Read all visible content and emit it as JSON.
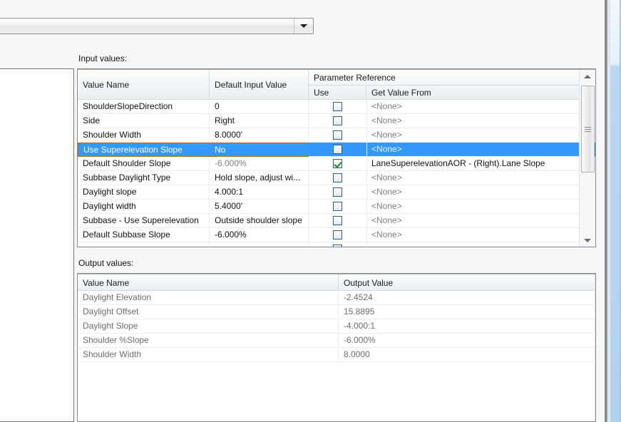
{
  "combo": {
    "value": "",
    "placeholder": "",
    "arrow_icon": "chevron-down-icon"
  },
  "sections": {
    "input_caption": "Input values:",
    "output_caption": "Output values:"
  },
  "input_table": {
    "headers": {
      "value_name": "Value Name",
      "default_input_value": "Default Input Value",
      "parameter_reference": "Parameter Reference",
      "use": "Use",
      "get_value_from": "Get Value From"
    },
    "rows": [
      {
        "name": "ShoulderSlopeDirection",
        "value": "0",
        "value_dim": false,
        "use": false,
        "source": "<None>",
        "source_dim": true,
        "selected": false
      },
      {
        "name": "Side",
        "value": "Right",
        "value_dim": false,
        "use": false,
        "source": "<None>",
        "source_dim": true,
        "selected": false
      },
      {
        "name": "Shoulder Width",
        "value": "8.0000'",
        "value_dim": false,
        "use": false,
        "source": "<None>",
        "source_dim": true,
        "selected": false
      },
      {
        "name": "Use Superelevation Slope",
        "value": "No",
        "value_dim": false,
        "use": false,
        "source": "<None>",
        "source_dim": true,
        "selected": true
      },
      {
        "name": "Default Shoulder Slope",
        "value": "-6.000%",
        "value_dim": true,
        "use": true,
        "source": "LaneSuperelevationAOR - (Right).Lane Slope",
        "source_dim": false,
        "selected": false
      },
      {
        "name": "Subbase Daylight Type",
        "value": "Hold slope, adjust wi...",
        "value_dim": false,
        "use": false,
        "source": "<None>",
        "source_dim": true,
        "selected": false
      },
      {
        "name": "Daylight slope",
        "value": "4.000:1",
        "value_dim": false,
        "use": false,
        "source": "<None>",
        "source_dim": true,
        "selected": false
      },
      {
        "name": "Daylight width",
        "value": "5.4000'",
        "value_dim": false,
        "use": false,
        "source": "<None>",
        "source_dim": true,
        "selected": false
      },
      {
        "name": "Subbase - Use Superelevation",
        "value": "Outside shoulder slope",
        "value_dim": false,
        "use": false,
        "source": "<None>",
        "source_dim": true,
        "selected": false
      },
      {
        "name": "Default Subbase Slope",
        "value": "-6.000%",
        "value_dim": false,
        "use": false,
        "source": "<None>",
        "source_dim": true,
        "selected": false
      },
      {
        "name": "",
        "value": "",
        "value_dim": false,
        "use": false,
        "source": "",
        "source_dim": true,
        "selected": false
      }
    ],
    "scrollbar": {
      "up_icon": "triangle-up-icon",
      "down_icon": "triangle-down-icon",
      "thumb_icon": "scroll-thumb-grip"
    }
  },
  "output_table": {
    "headers": {
      "value_name": "Value Name",
      "output_value": "Output Value"
    },
    "rows": [
      {
        "name": "Daylight Elevation",
        "value": "-2.4524"
      },
      {
        "name": "Daylight Offset",
        "value": "15.8895"
      },
      {
        "name": "Daylight Slope",
        "value": "-4.000:1"
      },
      {
        "name": "Shoulder %Slope",
        "value": "-6.000%"
      },
      {
        "name": "Shoulder Width",
        "value": "8.0000"
      }
    ]
  },
  "colors": {
    "selection": "#3399ff",
    "selection_focus_border": "#c86a14",
    "checkbox_border": "#2d5f8b",
    "check_mark": "#1f8a2a",
    "dim_text": "#808080",
    "window_glass": "#b3d2ec"
  }
}
